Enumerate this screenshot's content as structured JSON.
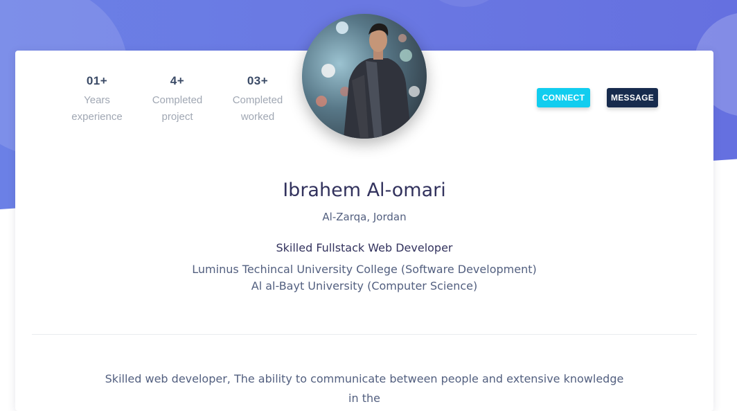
{
  "profile": {
    "stats": [
      {
        "value": "01+",
        "label_line1": "Years",
        "label_line2": "experience"
      },
      {
        "value": "4+",
        "label_line1": "Completed",
        "label_line2": "project"
      },
      {
        "value": "03+",
        "label_line1": "Completed",
        "label_line2": "worked"
      }
    ],
    "buttons": {
      "connect": "CONNECT",
      "message": "MESSAGE"
    },
    "name": "Ibrahem Al-omari",
    "location": "Al-Zarqa, Jordan",
    "job_title": "Skilled Fullstack Web Developer",
    "education": [
      "Luminus Techincal University College (Software Development)",
      "Al al-Bayt University (Computer Science)"
    ],
    "bio": "Skilled web developer, The ability to communicate between people and extensive knowledge in the"
  },
  "colors": {
    "hero_gradient_start": "#6b80e6",
    "hero_gradient_end": "#6570e0",
    "connect_button": "#11cdef",
    "message_button": "#172b4d",
    "heading_text": "#32325d",
    "muted_text": "#a0a7b3"
  },
  "icons": {
    "avatar": "profile-photo"
  }
}
